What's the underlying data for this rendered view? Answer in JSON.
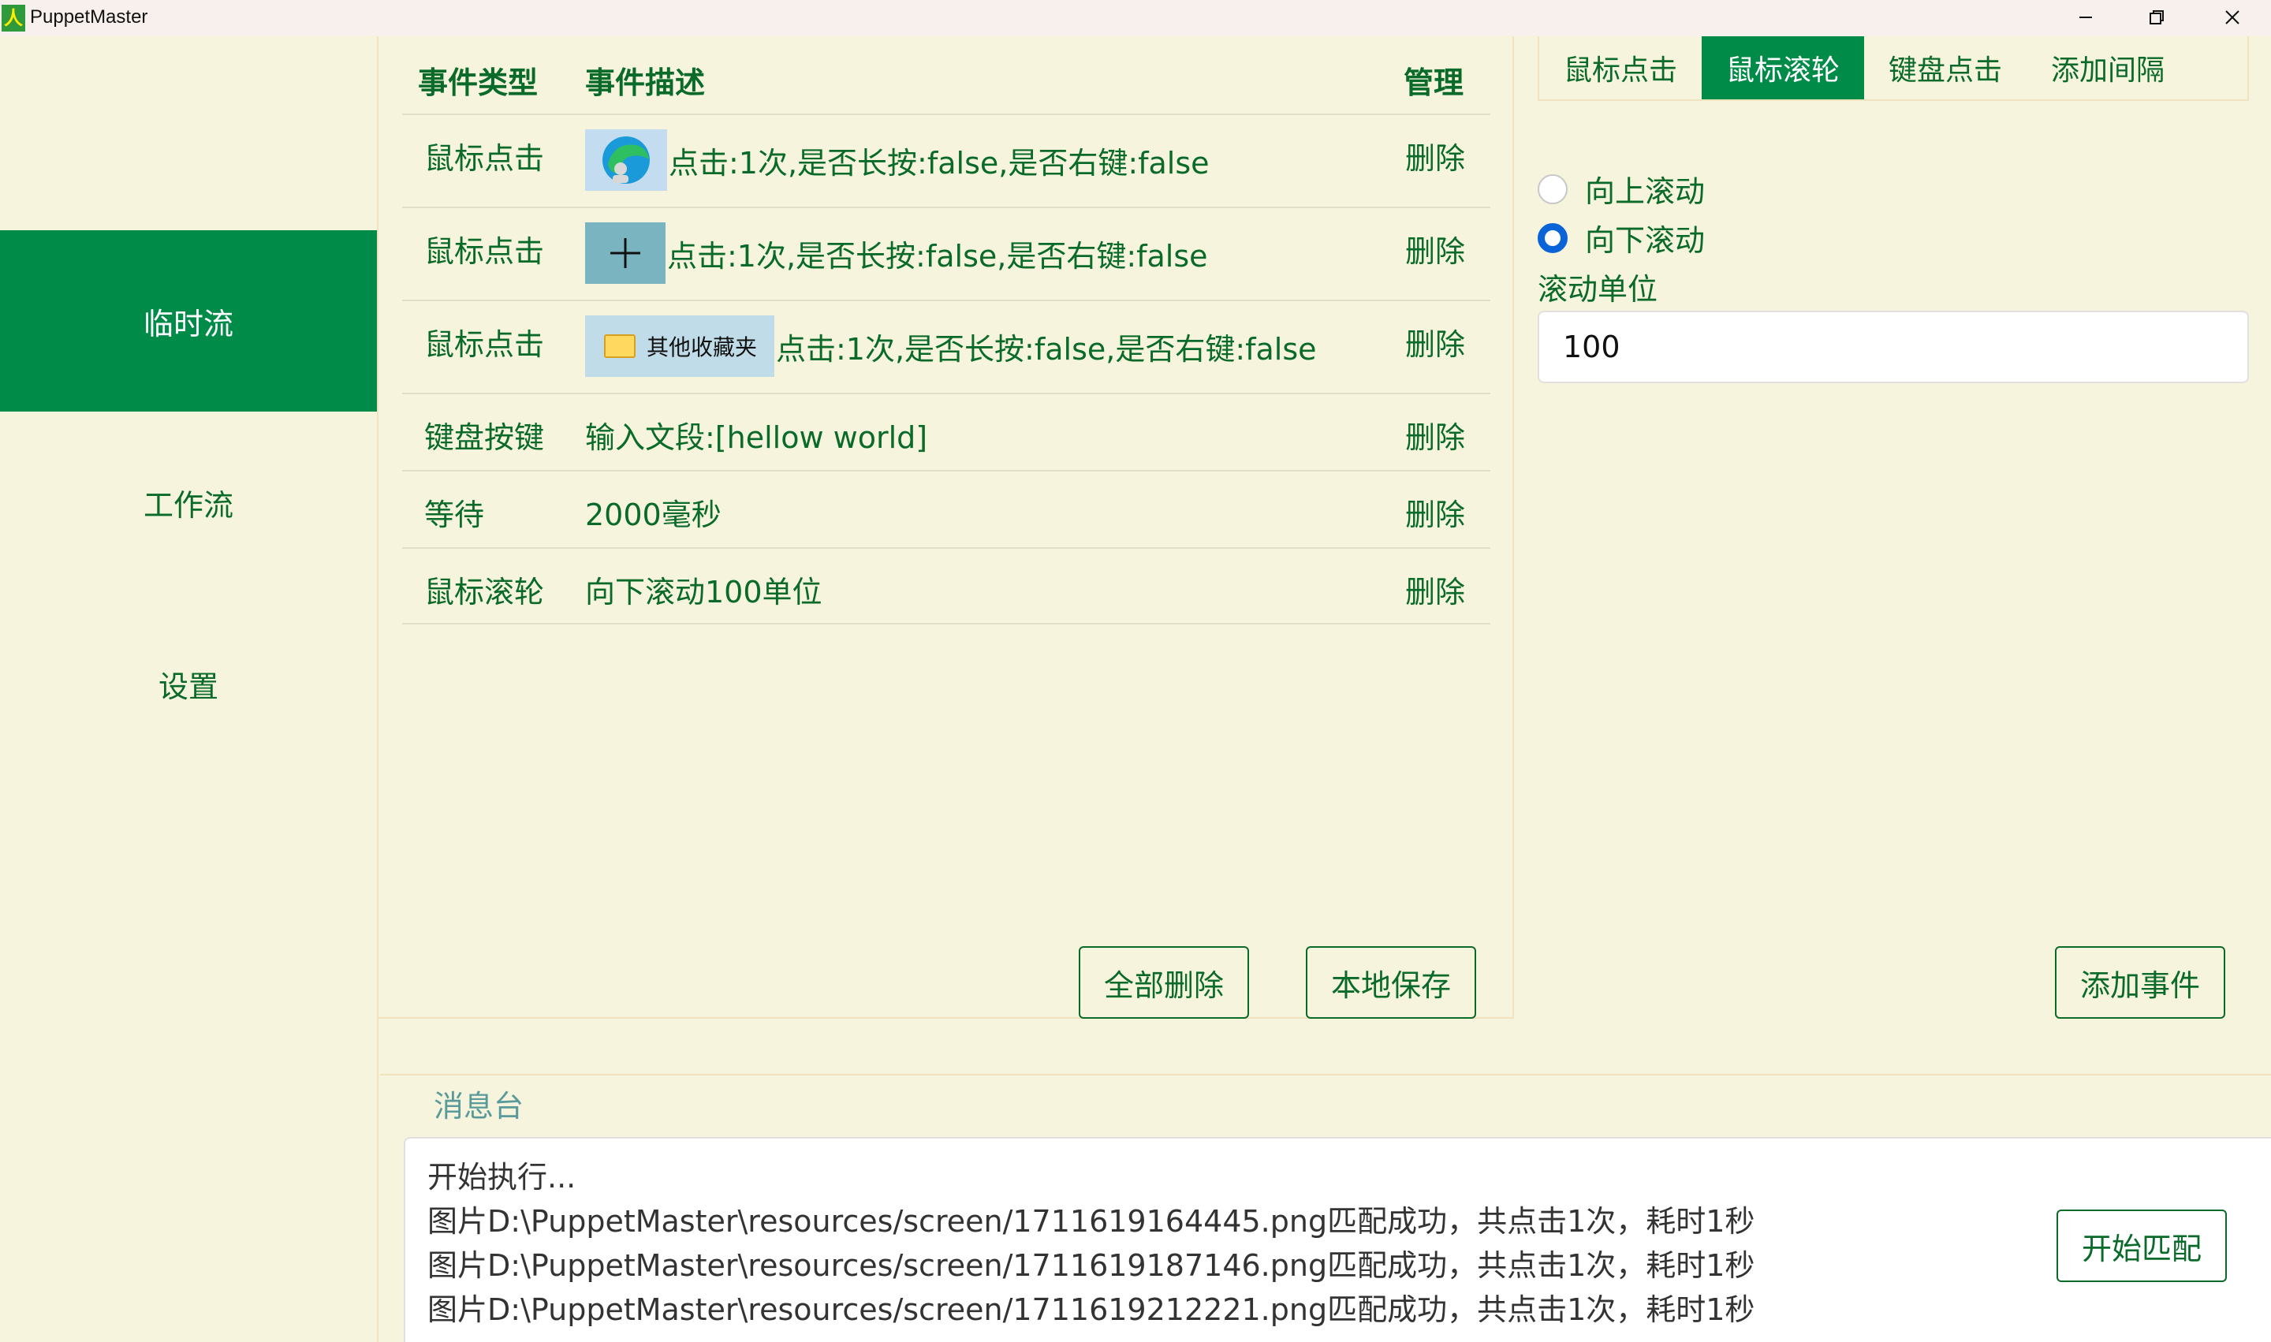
{
  "window": {
    "title": "PuppetMaster",
    "icon_glyph": "人",
    "minimize_icon": "minimize-icon",
    "restore_icon": "restore-icon",
    "close_icon": "close-icon"
  },
  "sidebar": {
    "items": [
      {
        "label": "临时流",
        "active": true
      },
      {
        "label": "工作流",
        "active": false
      },
      {
        "label": "设置",
        "active": false
      }
    ]
  },
  "events_table": {
    "headers": {
      "type": "事件类型",
      "desc": "事件描述",
      "manage": "管理"
    },
    "rows": [
      {
        "type": "鼠标点击",
        "thumb": "edge-icon",
        "desc": "点击:1次,是否长按:false,是否右键:false",
        "action": "删除"
      },
      {
        "type": "鼠标点击",
        "thumb": "plus-icon",
        "desc": "点击:1次,是否长按:false,是否右键:false",
        "action": "删除"
      },
      {
        "type": "鼠标点击",
        "thumb": "folder-icon",
        "thumb_text": "其他收藏夹",
        "desc": "点击:1次,是否长按:false,是否右键:false",
        "action": "删除"
      },
      {
        "type": "键盘按键",
        "desc": "输入文段:[hellow world]",
        "action": "删除"
      },
      {
        "type": "等待",
        "desc": "2000毫秒",
        "action": "删除"
      },
      {
        "type": "鼠标滚轮",
        "desc": "向下滚动100单位",
        "action": "删除"
      }
    ],
    "delete_all_label": "全部删除",
    "save_local_label": "本地保存"
  },
  "event_editor": {
    "tabs": [
      {
        "label": "鼠标点击",
        "active": false
      },
      {
        "label": "鼠标滚轮",
        "active": true
      },
      {
        "label": "键盘点击",
        "active": false
      },
      {
        "label": "添加间隔",
        "active": false
      }
    ],
    "scroll_up_label": "向上滚动",
    "scroll_down_label": "向下滚动",
    "selected_direction": "向下滚动",
    "unit_label": "滚动单位",
    "unit_value": "100",
    "add_event_label": "添加事件"
  },
  "console": {
    "title": "消息台",
    "lines": [
      "开始执行...",
      "图片D:\\PuppetMaster\\resources/screen/1711619164445.png匹配成功，共点击1次，耗时1秒",
      "图片D:\\PuppetMaster\\resources/screen/1711619187146.png匹配成功，共点击1次，耗时1秒",
      "图片D:\\PuppetMaster\\resources/screen/1711619212221.png匹配成功，共点击1次，耗时1秒"
    ],
    "start_match_label": "开始匹配"
  },
  "colors": {
    "accent": "#008c48",
    "background": "#f6f4dc",
    "text_green": "#0a6a2a",
    "radio_blue": "#0a64d8"
  }
}
